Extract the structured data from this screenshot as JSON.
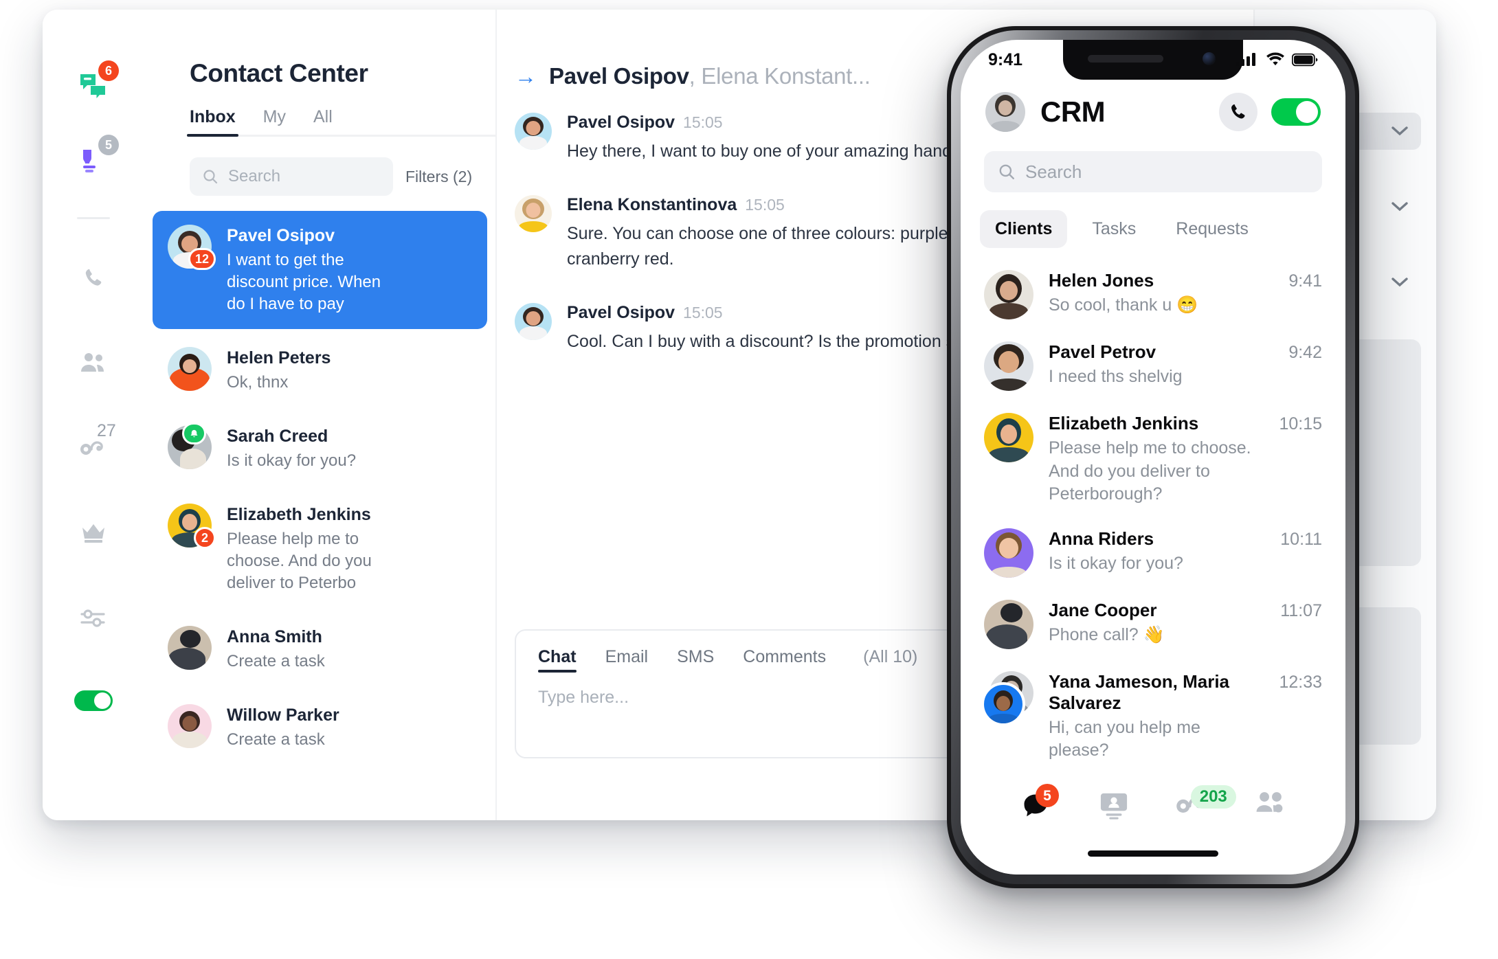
{
  "desktop": {
    "window_controls": {
      "colors": [
        "#00C814",
        "#FFC021",
        "#F4381C"
      ]
    },
    "rail": [
      {
        "name": "conversations",
        "icon": "chat-bubbles-icon",
        "color": "#20C997",
        "badge": "6",
        "badge_color": "#F4451E"
      },
      {
        "name": "knowledge",
        "icon": "lightbulb-person-icon",
        "color": "#7C5CFC",
        "badge": "5",
        "badge_color": "#B4BAC2"
      },
      {
        "name": "calls",
        "icon": "phone-icon",
        "color": "#C2C7CD",
        "badge": ""
      },
      {
        "name": "contacts",
        "icon": "people-icon",
        "color": "#C2C7CD",
        "badge": ""
      },
      {
        "name": "agents",
        "icon": "headset-icon",
        "color": "#C2C7CD",
        "badge": "27"
      },
      {
        "name": "premium",
        "icon": "crown-icon",
        "color": "#C2C7CD",
        "badge": ""
      },
      {
        "name": "settings",
        "icon": "sliders-icon",
        "color": "#C2C7CD",
        "badge": ""
      },
      {
        "name": "online-toggle",
        "icon": "toggle-icon",
        "color": "#00B84C",
        "badge": ""
      }
    ],
    "panel": {
      "title": "Contact Center",
      "tabs": [
        {
          "label": "Inbox",
          "active": true
        },
        {
          "label": "My",
          "active": false
        },
        {
          "label": "All",
          "active": false
        }
      ],
      "search": {
        "placeholder": "Search",
        "value": ""
      },
      "filters_label": "Filters (2)",
      "conversations": [
        {
          "name": "Pavel Osipov",
          "preview": "I want to get the discount price. When do I have to pay",
          "badge": "12",
          "badge_color": "#F4451E",
          "selected": true,
          "badge_kind": "count"
        },
        {
          "name": "Helen Peters",
          "preview": "Ok, thnx",
          "badge": "",
          "selected": false,
          "badge_kind": "none"
        },
        {
          "name": "Sarah Creed",
          "preview": "Is it okay for you?",
          "badge": "",
          "badge_color": "#17C964",
          "selected": false,
          "badge_kind": "bell"
        },
        {
          "name": "Elizabeth Jenkins",
          "preview": "Please help me to choose. And do you deliver to Peterbo",
          "badge": "2",
          "badge_color": "#F4451E",
          "selected": false,
          "badge_kind": "count"
        },
        {
          "name": "Anna Smith",
          "preview": "Create a task",
          "badge": "",
          "selected": false,
          "badge_kind": "none"
        },
        {
          "name": "Willow Parker",
          "preview": "Create a task",
          "badge": "",
          "selected": false,
          "badge_kind": "none"
        }
      ]
    },
    "chat": {
      "header": {
        "icon": "arrow-right-icon",
        "primary_name": "Pavel Osipov",
        "secondary_names": ", Elena Konstant...",
        "actions": [
          {
            "name": "forward-icon",
            "color": "#16C04B"
          },
          {
            "name": "block-icon",
            "color": "#FB5A3D"
          }
        ]
      },
      "messages": [
        {
          "author": "Pavel Osipov",
          "time": "15:05",
          "text": "Hey there, I want to buy one of your amazing handma"
        },
        {
          "author": "Elena Konstantinova",
          "time": "15:05",
          "text": "Sure. You can choose one of three colours: purple, gr\ncranberry red."
        },
        {
          "author": "Pavel Osipov",
          "time": "15:05",
          "text": "Cool. Can I buy with a discount? Is the promotion still"
        }
      ],
      "composer": {
        "tabs": [
          {
            "label": "Chat",
            "active": true
          },
          {
            "label": "Email",
            "active": false
          },
          {
            "label": "SMS",
            "active": false
          },
          {
            "label": "Comments",
            "active": false
          }
        ],
        "count_label": "(All 10)",
        "placeholder": "Type here...",
        "icons": [
          "translate-icon",
          "paperclip-icon",
          "emoji-icon"
        ]
      }
    },
    "right_panel": {
      "rows": [
        {
          "icon": "chevron-down-icon",
          "filled": true
        },
        {
          "icon": "chevron-down-icon",
          "filled": false
        },
        {
          "icon": "chevron-down-icon",
          "filled": false
        }
      ],
      "cards": [
        {
          "icon": "pencil-icon",
          "size": "tall"
        },
        {
          "icon": "pencil-icon",
          "size": "short"
        }
      ]
    }
  },
  "phone": {
    "status": {
      "time": "9:41",
      "icons": [
        "cellular-icon",
        "wifi-icon",
        "battery-icon"
      ]
    },
    "header": {
      "avatar": "user-avatar",
      "title": "CRM",
      "call_icon": "phone-icon",
      "toggle": {
        "icon": "toggle-icon",
        "on": true,
        "color": "#00C94B"
      }
    },
    "search": {
      "placeholder": "Search",
      "value": "",
      "icon": "search-icon"
    },
    "tabs": [
      {
        "label": "Clients",
        "active": true
      },
      {
        "label": "Tasks",
        "active": false
      },
      {
        "label": "Requests",
        "active": false
      }
    ],
    "rows": [
      {
        "name": "Helen Jones",
        "preview": "So cool, thank u 😁",
        "time": "9:41",
        "avatar_kind": "single",
        "avatar_bg": "#e7e4dd"
      },
      {
        "name": "Pavel Petrov",
        "preview": "I need ths shelvig",
        "time": "9:42",
        "avatar_kind": "single",
        "avatar_bg": "#dfe3e8"
      },
      {
        "name": "Elizabeth Jenkins",
        "preview": "Please help me to choose. And do you deliver to Peterborough?",
        "time": "10:15",
        "avatar_kind": "single",
        "avatar_bg": "#F5C518"
      },
      {
        "name": "Anna Riders",
        "preview": "Is it okay for you?",
        "time": "10:11",
        "avatar_kind": "single",
        "avatar_bg": "#8C6CF0"
      },
      {
        "name": "Jane Cooper",
        "preview": "Phone call? 👋",
        "time": "11:07",
        "avatar_kind": "single",
        "avatar_bg": "#cdbfae"
      },
      {
        "name": "Yana Jameson, Maria Salvarez",
        "preview": "Hi, can you help me please?",
        "time": "12:33",
        "avatar_kind": "stack",
        "avatar_bg": "#d7d9dc"
      }
    ],
    "nav": [
      {
        "icon": "chat-bubble-icon",
        "active": true,
        "badge": "5",
        "badge_kind": "count",
        "badge_color": "#F4451E"
      },
      {
        "icon": "contact-card-icon",
        "active": false,
        "badge": "",
        "badge_kind": "none"
      },
      {
        "icon": "headset-icon",
        "active": false,
        "badge": "203",
        "badge_kind": "pill",
        "badge_color": "#14A44A"
      },
      {
        "icon": "group-icon",
        "active": false,
        "badge": "",
        "badge_kind": "none"
      }
    ]
  }
}
